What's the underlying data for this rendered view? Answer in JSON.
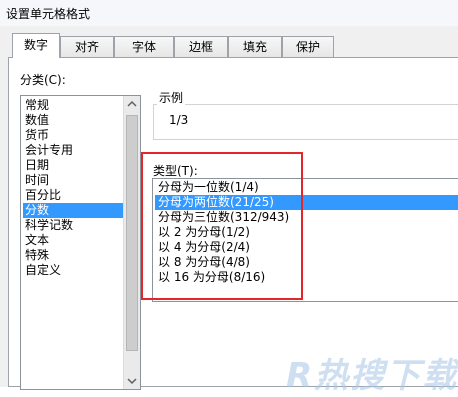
{
  "window": {
    "title": "设置单元格格式"
  },
  "tabs": [
    {
      "label": "数字",
      "active": true
    },
    {
      "label": "对齐"
    },
    {
      "label": "字体"
    },
    {
      "label": "边框"
    },
    {
      "label": "填充"
    },
    {
      "label": "保护"
    }
  ],
  "category": {
    "label": "分类(C):",
    "items": [
      "常规",
      "数值",
      "货币",
      "会计专用",
      "日期",
      "时间",
      "百分比",
      "分数",
      "科学记数",
      "文本",
      "特殊",
      "自定义"
    ],
    "selected_index": 7
  },
  "sample": {
    "label": "示例",
    "value": "1/3"
  },
  "type": {
    "label": "类型(T):",
    "items": [
      "分母为一位数(1/4)",
      "分母为两位数(21/25)",
      "分母为三位数(312/943)",
      "以 2 为分母(1/2)",
      "以 4 为分母(2/4)",
      "以 8 为分母(4/8)",
      "以 16 为分母(8/16)"
    ],
    "selected_index": 1
  },
  "colors": {
    "selection": "#3399ff",
    "highlight_box": "#e2262a"
  },
  "watermark": {
    "text": "R热搜下载"
  }
}
